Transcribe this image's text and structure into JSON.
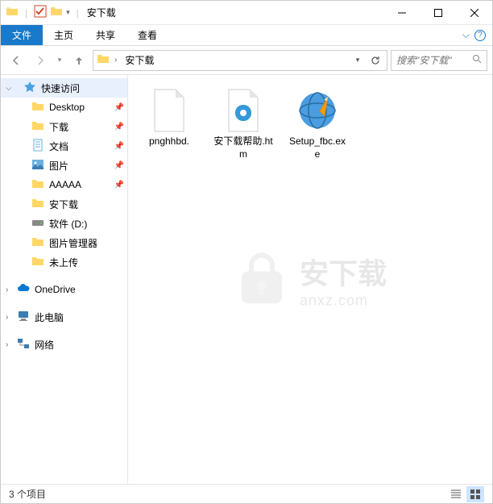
{
  "window": {
    "title": "安下载"
  },
  "ribbon": {
    "file": "文件",
    "home": "主页",
    "share": "共享",
    "view": "查看"
  },
  "nav": {
    "crumb": "安下载",
    "search_placeholder": "搜索\"安下载\""
  },
  "sidebar": {
    "quick_access": "快速访问",
    "items": [
      {
        "label": "Desktop",
        "pinned": true
      },
      {
        "label": "下载",
        "pinned": true
      },
      {
        "label": "文档",
        "pinned": true
      },
      {
        "label": "图片",
        "pinned": true
      },
      {
        "label": "AAAAA",
        "pinned": true
      },
      {
        "label": "安下载"
      },
      {
        "label": "软件 (D:)"
      },
      {
        "label": "图片管理器"
      },
      {
        "label": "未上传"
      }
    ],
    "onedrive": "OneDrive",
    "thispc": "此电脑",
    "network": "网络"
  },
  "files": [
    {
      "name": "pnghhbd."
    },
    {
      "name": "安下载帮助.htm"
    },
    {
      "name": "Setup_fbc.exe"
    }
  ],
  "status": {
    "count": "3 个项目"
  },
  "watermark": {
    "cn": "安下载",
    "en": "anxz.com"
  }
}
